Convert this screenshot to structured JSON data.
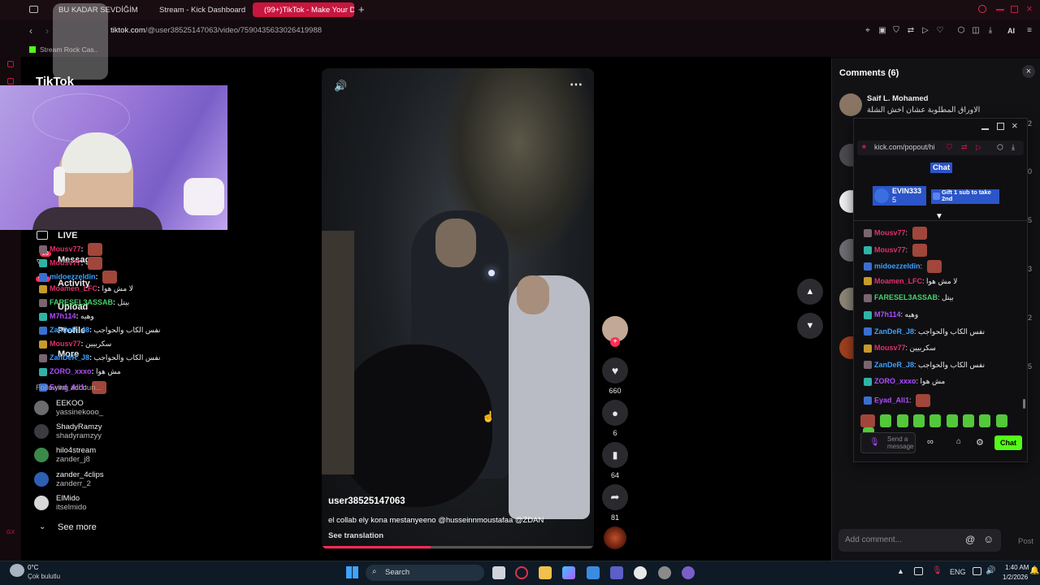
{
  "browser": {
    "tabs": [
      {
        "label": "BU KADAR SEVDİĞİM",
        "active": false
      },
      {
        "label": "Stream - Kick Dashboard",
        "active": false
      },
      {
        "label": "(99+)TikTok - Make Your D",
        "active": true
      }
    ],
    "url_host": "tiktok.com",
    "url_path": "/@user38525147063/video/7590435633026419988",
    "bookmark": "Stream Rock Cas..",
    "ai_label": "AI"
  },
  "tiktok": {
    "logo": "TikTok",
    "nav": {
      "live": "LIVE",
      "messages": "Messages",
      "messages_badge": "26",
      "activity": "Activity",
      "activity_badge": "99+",
      "upload": "Upload",
      "profile": "Profile",
      "more": "More"
    },
    "following_label": "Following accoun...",
    "accounts": [
      {
        "name": "EEKOO",
        "handle": "yassinekooo_"
      },
      {
        "name": "ShadyRamzy",
        "handle": "shadyramzyy"
      },
      {
        "name": "hilo4stream",
        "handle": "zander_j8"
      },
      {
        "name": "zander_4clips",
        "handle": "zanderr_2"
      },
      {
        "name": "ElMido",
        "handle": "itselmido"
      }
    ],
    "see_more": "See more",
    "footer_mark": "GX",
    "video": {
      "author": "user38525147063",
      "caption": "el collab ely kona mestanyeeno @husseinnmoustafaa @ZDAN",
      "see_translation": "See translation",
      "progress": 0.4
    },
    "actions": {
      "likes": "660",
      "comments": "6",
      "saves": "64",
      "shares": "81"
    },
    "comments": {
      "title": "Comments (6)",
      "first_name": "Saif L. Mohamed",
      "first_text": "الاوراق المطلوبة عشان اخش الشلة ديه",
      "side_counts": [
        "2",
        "0",
        "5",
        "3",
        "2",
        "5"
      ],
      "add_placeholder": "Add comment...",
      "post": "Post"
    }
  },
  "overlay_chat": [
    {
      "user": "Mousv77",
      "text": "",
      "color": "#e0306a"
    },
    {
      "user": "Mousv77",
      "text": "",
      "color": "#e0306a"
    },
    {
      "user": "midoezzeldin",
      "text": "",
      "color": "#3aa0ff"
    },
    {
      "user": "Moamen_LFC",
      "text": "لا مش هوا",
      "color": "#e0306a"
    },
    {
      "user": "FARESEL3ASSAB",
      "text": "بيتل",
      "color": "#46d36a"
    },
    {
      "user": "M7h114",
      "text": "وهيه",
      "color": "#b14cff"
    },
    {
      "user": "ZanDeR_J8",
      "text": "نفس الكاب والحواجب",
      "color": "#3aa0ff"
    },
    {
      "user": "Mousv77",
      "text": "سكربيين",
      "color": "#e0306a"
    },
    {
      "user": "ZanDeR_J8",
      "text": "نفس الكاب والحواجب",
      "color": "#3aa0ff"
    },
    {
      "user": "ZORO_xxxo",
      "text": "مش هوا",
      "color": "#b14cff"
    },
    {
      "user": "Eyad_Ali1",
      "text": "",
      "color": "#b14cff"
    }
  ],
  "kick": {
    "url": "kick.com/popout/hi",
    "chat_title": "Chat",
    "pinned_user": "EVIN333",
    "pinned_count": "5",
    "gift_text": "Gift 1 sub to take 2nd",
    "messages": [
      {
        "user": "Mousv77",
        "text": "",
        "color": "#e0306a"
      },
      {
        "user": "Mousv77",
        "text": "",
        "color": "#e0306a"
      },
      {
        "user": "midoezzeldin",
        "text": "",
        "color": "#3aa0ff"
      },
      {
        "user": "Moamen_LFC",
        "text": "لا مش هوا",
        "color": "#e0306a"
      },
      {
        "user": "FARESEL3ASSAB",
        "text": "بيتل",
        "color": "#46d36a"
      },
      {
        "user": "M7h114",
        "text": "وهيه",
        "color": "#b14cff"
      },
      {
        "user": "ZanDeR_J8",
        "text": "نفس الكاب والحواجب",
        "color": "#3aa0ff"
      },
      {
        "user": "Mousv77",
        "text": "سكربيين",
        "color": "#e0306a"
      },
      {
        "user": "ZanDeR_J8",
        "text": "نفس الكاب والحواجب",
        "color": "#3aa0ff"
      },
      {
        "user": "ZORO_xxxo",
        "text": "مش هوا",
        "color": "#b14cff"
      },
      {
        "user": "Eyad_Ali1",
        "text": "",
        "color": "#b14cff"
      }
    ],
    "input_placeholder": "Send a message",
    "send_button": "Chat",
    "accent": "#53fc18"
  },
  "taskbar": {
    "weather_temp": "0°C",
    "weather_text": "Çok bulutlu",
    "search": "Search",
    "lang": "ENG",
    "time": "1:40 AM",
    "date": "1/2/2026"
  }
}
